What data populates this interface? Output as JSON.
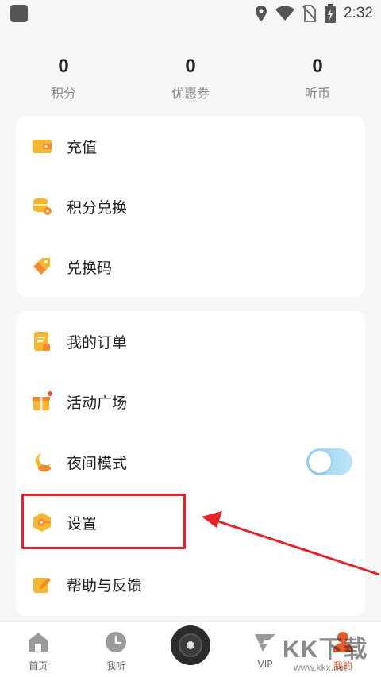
{
  "status_bar": {
    "time": "2:32",
    "icons": [
      "location-icon",
      "wifi-icon",
      "no-sim-icon",
      "battery-charging-icon"
    ]
  },
  "stats": [
    {
      "value": "0",
      "label": "积分"
    },
    {
      "value": "0",
      "label": "优惠券"
    },
    {
      "value": "0",
      "label": "听币"
    }
  ],
  "menu_group_1": [
    {
      "label": "充值",
      "icon": "wallet-icon"
    },
    {
      "label": "积分兑换",
      "icon": "coins-exchange-icon"
    },
    {
      "label": "兑换码",
      "icon": "tag-icon"
    }
  ],
  "menu_group_2": [
    {
      "label": "我的订单",
      "icon": "order-icon"
    },
    {
      "label": "活动广场",
      "icon": "gift-icon"
    },
    {
      "label": "夜间模式",
      "icon": "moon-icon",
      "toggle": "off"
    },
    {
      "label": "设置",
      "icon": "settings-hex-icon"
    },
    {
      "label": "帮助与反馈",
      "icon": "pencil-icon"
    }
  ],
  "bottom_nav": [
    {
      "label": "首页",
      "icon": "home-icon"
    },
    {
      "label": "我听",
      "icon": "clock-icon"
    },
    {
      "label": "",
      "icon": "player-disc-icon"
    },
    {
      "label": "VIP",
      "icon": "vip-icon"
    },
    {
      "label": "我的",
      "icon": "profile-icon",
      "active": true
    }
  ],
  "watermark": {
    "main": "KK下载",
    "sub": "www.kkx.net"
  },
  "colors": {
    "accent": "#e8592e",
    "icon_yellow": "#f5b731",
    "icon_orange": "#f28a2e",
    "highlight": "#e8202a"
  }
}
